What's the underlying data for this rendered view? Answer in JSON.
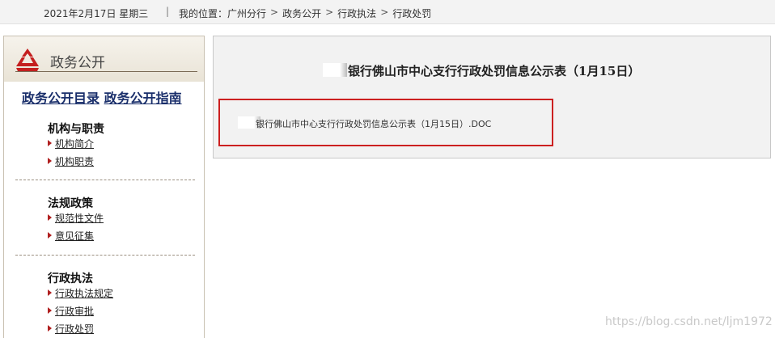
{
  "topbar": {
    "date": "2021年2月17日  星期三",
    "separator": "|",
    "location_label": "我的位置：",
    "crumbs": [
      "广州分行",
      "政务公开",
      "行政执法",
      "行政处罚"
    ],
    "arrow": ">"
  },
  "sidebar": {
    "title": "政务公开",
    "link_catalog": "政务公开目录",
    "link_guide": "政务公开指南",
    "sections": [
      {
        "heading": "机构与职责",
        "items": [
          "机构简介",
          "机构职责"
        ]
      },
      {
        "heading": "法规政策",
        "items": [
          "规范性文件",
          "意见征集"
        ]
      },
      {
        "heading": "行政执法",
        "items": [
          "行政执法规定",
          "行政审批",
          "行政处罚"
        ]
      }
    ]
  },
  "main": {
    "title": "银行佛山市中心支行行政处罚信息公示表（1月15日）",
    "file_link": "银行佛山市中心支行行政处罚信息公示表（1月15日）.DOC"
  },
  "watermark": "https://blog.csdn.net/ljm1972",
  "colors": {
    "highlight_border": "#cc2020",
    "link_navy": "#1a2f6b",
    "bullet_red": "#b01f1f"
  }
}
